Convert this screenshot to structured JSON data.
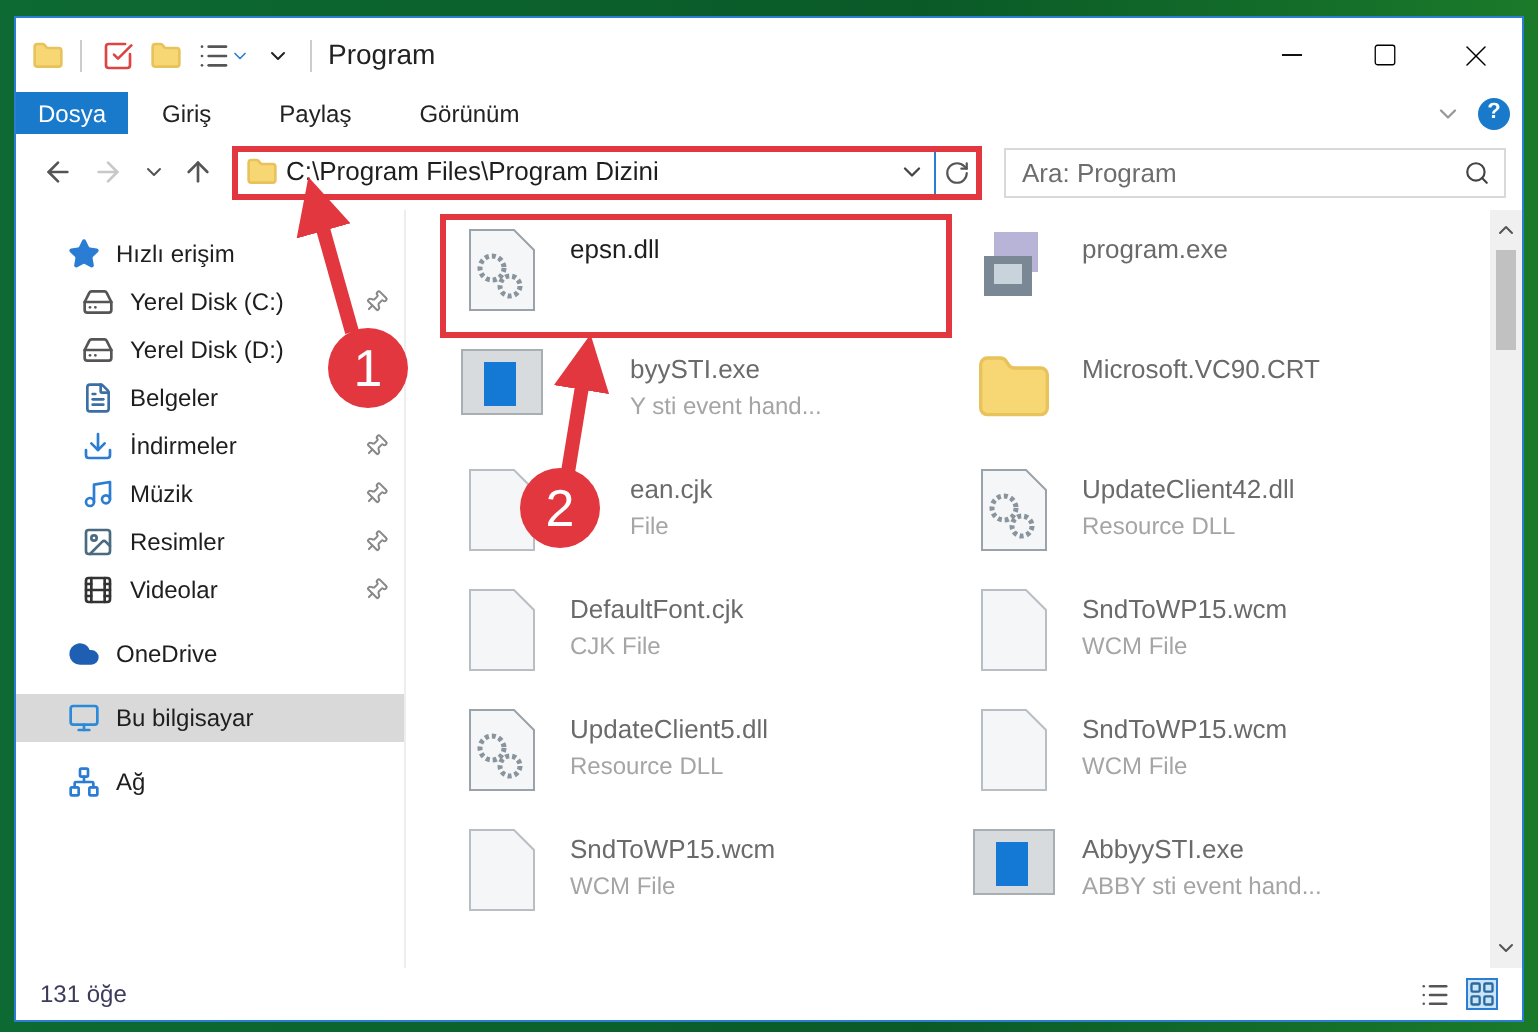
{
  "window": {
    "title": "Program"
  },
  "ribbon_tabs": [
    {
      "label": "Dosya",
      "selected": true
    },
    {
      "label": "Giriş",
      "selected": false
    },
    {
      "label": "Paylaş",
      "selected": false
    },
    {
      "label": "Görünüm",
      "selected": false
    }
  ],
  "help": "?",
  "address": {
    "path": "C:\\Program Files\\Program Dizini",
    "highlighted": true
  },
  "search": {
    "placeholder": "Ara: Program"
  },
  "sidebar": {
    "items": [
      {
        "label": "Hızlı erişim",
        "kind": "star",
        "pinned": false,
        "selected": false,
        "children": [
          {
            "label": "Yerel Disk (C:)",
            "kind": "diskc",
            "pinned": true,
            "selected": false
          },
          {
            "label": "Yerel Disk (D:)",
            "kind": "disk",
            "pinned": false,
            "selected": false
          },
          {
            "label": "Belgeler",
            "kind": "docs",
            "pinned": false,
            "selected": false
          },
          {
            "label": "İndirmeler",
            "kind": "download",
            "pinned": true,
            "selected": false
          },
          {
            "label": "Müzik",
            "kind": "music",
            "pinned": true,
            "selected": false
          },
          {
            "label": "Resimler",
            "kind": "pictures",
            "pinned": true,
            "selected": false
          },
          {
            "label": "Videolar",
            "kind": "videos",
            "pinned": true,
            "selected": false
          }
        ]
      },
      {
        "label": "OneDrive",
        "kind": "cloud",
        "pinned": false,
        "selected": false
      },
      {
        "label": "Bu bilgisayar",
        "kind": "pc",
        "pinned": false,
        "selected": true
      },
      {
        "label": "Ağ",
        "kind": "network",
        "pinned": false,
        "selected": false
      }
    ]
  },
  "files": [
    {
      "name": "epsn.dll",
      "kind": "dll",
      "highlighted": true
    },
    {
      "name": "program.exe",
      "kind": "installer",
      "highlighted": false
    },
    {
      "name": "byySTI.exe",
      "type": "Y sti event hand...",
      "kind": "exe",
      "highlighted": false,
      "partly_hidden": true
    },
    {
      "name": "Microsoft.VC90.CRT",
      "kind": "folder",
      "highlighted": false
    },
    {
      "name": "ean.cjk",
      "type": "File",
      "kind": "file",
      "highlighted": false,
      "partly_hidden": true
    },
    {
      "name": "UpdateClient42.dll",
      "type": "Resource DLL",
      "kind": "dll",
      "highlighted": false
    },
    {
      "name": "DefaultFont.cjk",
      "type": "CJK File",
      "kind": "file",
      "highlighted": false
    },
    {
      "name": "SndToWP15.wcm",
      "type": "WCM File",
      "kind": "file",
      "highlighted": false
    },
    {
      "name": "UpdateClient5.dll",
      "type": "Resource DLL",
      "kind": "dll",
      "highlighted": false
    },
    {
      "name": "SndToWP15.wcm",
      "type": "WCM File",
      "kind": "file",
      "highlighted": false
    },
    {
      "name": "SndToWP15.wcm",
      "type": "WCM File",
      "kind": "file",
      "highlighted": false
    },
    {
      "name": "AbbyySTI.exe",
      "type": "ABBY sti event hand...",
      "kind": "exe",
      "highlighted": false
    }
  ],
  "status_bar": {
    "count": "131 öğe"
  },
  "annotations": [
    {
      "number": "1"
    },
    {
      "number": "2"
    }
  ]
}
